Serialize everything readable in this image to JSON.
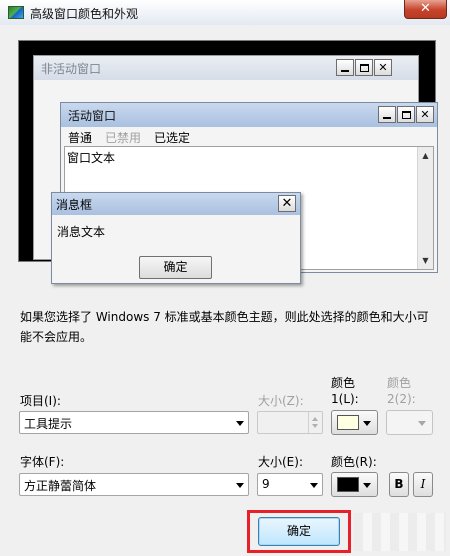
{
  "window": {
    "title": "高级窗口颜色和外观",
    "close_glyph": "✕"
  },
  "preview": {
    "inactive_title": "非活动窗口",
    "active_title": "活动窗口",
    "menu": [
      {
        "label": "普通",
        "state": "normal"
      },
      {
        "label": "已禁用",
        "state": "disabled"
      },
      {
        "label": "已选定",
        "state": "selected"
      }
    ],
    "window_text": "窗口文本",
    "message_box": {
      "title": "消息框",
      "text": "消息文本",
      "ok_label": "确定"
    },
    "caption_close": "✕"
  },
  "info_text": "如果您选择了 Windows 7 标准或基本颜色主题，则此处选择的颜色和大小可能不会应用。",
  "item": {
    "label": "项目(I):",
    "value": "工具提示"
  },
  "item_size": {
    "label": "大小(Z):",
    "value": ""
  },
  "color1": {
    "label_line1": "颜色",
    "label_line2": "1(L):",
    "value": "#ffffe1"
  },
  "color2": {
    "label_line1": "颜色",
    "label_line2": "2(2):",
    "value": ""
  },
  "font": {
    "label": "字体(F):",
    "value": "方正静蕾简体"
  },
  "font_size": {
    "label": "大小(E):",
    "value": "9"
  },
  "font_color": {
    "label": "颜色(R):",
    "value": "#000000"
  },
  "bold_label": "B",
  "italic_label": "I",
  "ok_label": "确定",
  "colors": {
    "highlight": "#e8202a",
    "active_title": "#a9c0e0"
  }
}
